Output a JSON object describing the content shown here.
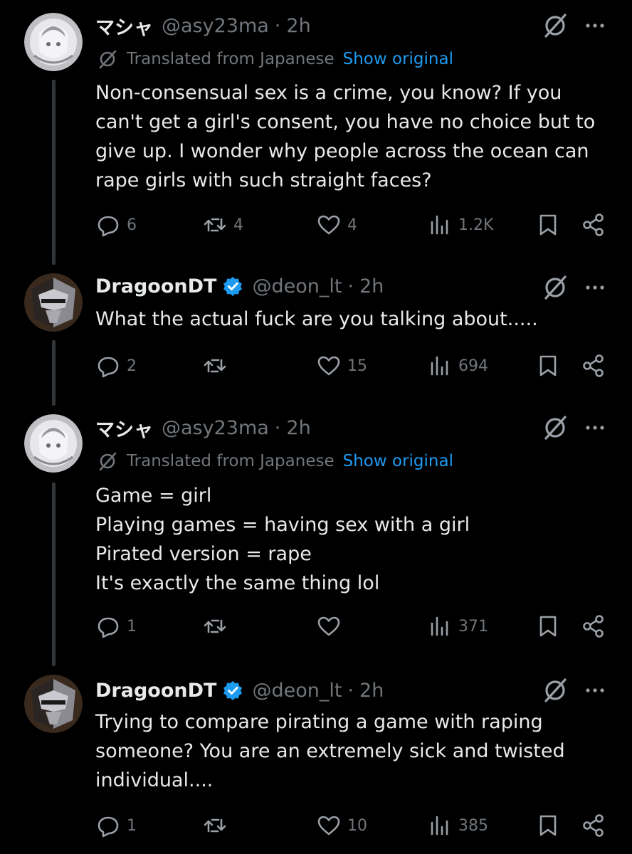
{
  "colors": {
    "background": "#000000",
    "text": "#e7e9ea",
    "muted": "#71767b",
    "link": "#1d9bf0",
    "verified": "#1d9bf0",
    "thread_line": "#333639"
  },
  "posts": [
    {
      "author": "マシャ",
      "handle": "@asy23ma",
      "separator": "·",
      "time": "2h",
      "verified": false,
      "translated_label": "Translated from Japanese",
      "show_original": "Show original",
      "text": "Non-consensual sex is a crime, you know? If you\ncan't get a girl's consent, you have no choice but to\ngive up. I wonder why people across the ocean can\nrape girls with such straight faces?",
      "replies": "6",
      "reposts": "4",
      "likes": "4",
      "views": "1.2K"
    },
    {
      "author": "DragoonDT",
      "handle": "@deon_lt",
      "separator": "·",
      "time": "2h",
      "verified": true,
      "text": "What the actual fuck are you talking about.....",
      "replies": "2",
      "reposts": "",
      "likes": "15",
      "views": "694"
    },
    {
      "author": "マシャ",
      "handle": "@asy23ma",
      "separator": "·",
      "time": "2h",
      "verified": false,
      "translated_label": "Translated from Japanese",
      "show_original": "Show original",
      "text": "Game = girl\nPlaying games = having sex with a girl\nPirated version = rape\nIt's exactly the same thing lol",
      "replies": "1",
      "reposts": "",
      "likes": "",
      "views": "371"
    },
    {
      "author": "DragoonDT",
      "handle": "@deon_lt",
      "separator": "·",
      "time": "2h",
      "verified": true,
      "text": "Trying to compare pirating a game with raping\nsomeone? You are an extremely sick and twisted\nindividual....",
      "replies": "1",
      "reposts": "",
      "likes": "10",
      "views": "385"
    }
  ]
}
